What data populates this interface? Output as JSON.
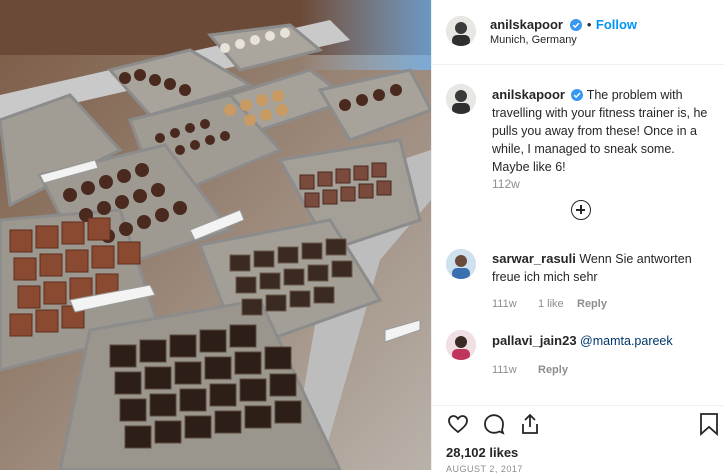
{
  "post": {
    "username": "anilskapoor",
    "follow_label": "Follow",
    "location": "Munich, Germany",
    "caption": "The problem with travelling with your fitness trainer is, he pulls you away from these! Once in a while, I managed to sneak some. Maybe like 6!",
    "caption_time": "112w",
    "likes": "28,102 likes",
    "date": "AUGUST 2, 2017",
    "image_alt": "Chocolate display case with truffles and pralines"
  },
  "comments": [
    {
      "username": "sarwar_rasuli",
      "text": "Wenn Sie antworten freue ich mich sehr",
      "time": "111w",
      "likes": "1 like",
      "reply": "Reply"
    },
    {
      "username": "pallavi_jain23",
      "text": "@mamta.pareek",
      "time": "111w",
      "reply": "Reply"
    }
  ],
  "colors": {
    "link": "#0095f6",
    "text": "#262626",
    "muted": "#8e8e8e",
    "verified": "#3897f0"
  },
  "icons": [
    "verified-badge-icon",
    "heart-icon",
    "comment-icon",
    "share-icon",
    "bookmark-icon",
    "add-comments-icon"
  ]
}
